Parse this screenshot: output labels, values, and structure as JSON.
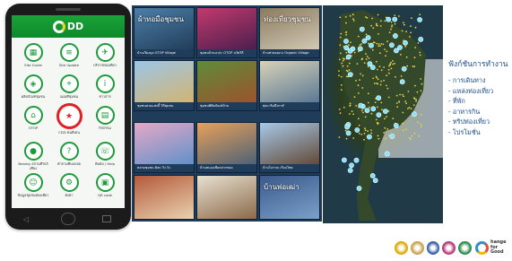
{
  "app": {
    "logo_text": "DD",
    "tiles": [
      {
        "label": "Site Guide",
        "icon": "building-icon"
      },
      {
        "label": "Site Update",
        "icon": "news-icon"
      },
      {
        "label": "บริการท่องเที่ยว",
        "icon": "tour-icon"
      },
      {
        "label": "ผลิตภัณฑ์ชุมชน",
        "icon": "product-icon"
      },
      {
        "label": "แผนที่ชุมชน",
        "icon": "map-icon"
      },
      {
        "label": "ข่าวสาร",
        "icon": "info-icon"
      },
      {
        "label": "OTOP",
        "icon": "shop-icon"
      },
      {
        "label": "CDD คนดีเด่น",
        "icon": "star-icon",
        "highlight": true
      },
      {
        "label": "กิจกรรม",
        "icon": "calendar-icon"
      },
      {
        "label": "Nearby สถานที่ใกล้เคียง",
        "icon": "pin-icon"
      },
      {
        "label": "คำถามที่พบบ่อย",
        "icon": "question-icon"
      },
      {
        "label": "ติดต่อ / Help",
        "icon": "phone-icon"
      },
      {
        "label": "ข้อมูลชุมชนท่องเที่ยว",
        "icon": "people-icon"
      },
      {
        "label": "ตั้งค่า",
        "icon": "gear-icon"
      },
      {
        "label": "QR code",
        "icon": "qr-icon"
      }
    ]
  },
  "collage": {
    "photos": [
      {
        "caption": "บ้านเวียงนุล OTOP Village",
        "overlay": "ผ้าทอมือชุมชน",
        "c1": "#4c7fa8",
        "c2": "#1d3550"
      },
      {
        "caption": "ชุมชนบ้านนาปะ OTOP นวัตวิถี",
        "overlay": "",
        "c1": "#c23a6d",
        "c2": "#3b1c4a"
      },
      {
        "caption": "บ้านท่าสองยาง Organic Village",
        "overlay": "ท่องเที่ยวชุมชน",
        "c1": "#8c7a5c",
        "c2": "#d9d2c2"
      },
      {
        "caption": "ชุมชนสวนแห่งนี้ วิถีชุมชน",
        "overlay": "",
        "c1": "#9cc6e8",
        "c2": "#d9b262"
      },
      {
        "caption": "ชุมชนพิพิธภัณฑ์บ้าน",
        "overlay": "",
        "c1": "#5e8c3a",
        "c2": "#a54b2a"
      },
      {
        "caption": "ทุ่งนาริมบึงกาฬ",
        "overlay": "",
        "c1": "#d8d2b8",
        "c2": "#4a6d8f"
      },
      {
        "caption": "ตลาดชุมชน Ban Tu Tu",
        "overlay": "",
        "c1": "#e6a8c8",
        "c2": "#4f8ec9"
      },
      {
        "caption": "บ้านหนองเขียดปากช่อง",
        "overlay": "",
        "c1": "#e8a05a",
        "c2": "#3a5a7a"
      },
      {
        "caption": "บ้านโบราณ เรือนไทย",
        "overlay": "",
        "c1": "#a7c9e8",
        "c2": "#5a3a22"
      },
      {
        "caption": "",
        "overlay": "",
        "c1": "#b55a3a",
        "c2": "#e8d2b0"
      },
      {
        "caption": "",
        "overlay": "",
        "c1": "#e8e0d0",
        "c2": "#8c6a4a"
      },
      {
        "caption": "",
        "overlay": "บ้านพ่อเฒ่า",
        "c1": "#3a5a8c",
        "c2": "#7aa0c8"
      }
    ]
  },
  "features": {
    "title": "ฟังก์ชันการทำงาน",
    "items": [
      "การเดินทาง",
      "แหล่งท่องเที่ยว",
      "ที่พัก",
      "อาหารกิน",
      "ทริปท่องเที่ยว",
      "โปรโมชั่น"
    ]
  },
  "colors": {
    "accent": "#1d9a3b",
    "text_blue": "#1a4d8c",
    "marker": "#7de3ff",
    "dot": "#e8d24a"
  },
  "footer": {
    "logos": [
      {
        "name": "garuda-seal",
        "color": "#e0a800"
      },
      {
        "name": "ministry-seal",
        "color": "#c9a24a"
      },
      {
        "name": "cdd-seal",
        "color": "#3a62a8"
      },
      {
        "name": "otop-seal",
        "color": "#b53a7a"
      },
      {
        "name": "agency-seal",
        "color": "#2a8a4a"
      }
    ],
    "tagline_line1": "hange",
    "tagline_line2": "for Good"
  }
}
